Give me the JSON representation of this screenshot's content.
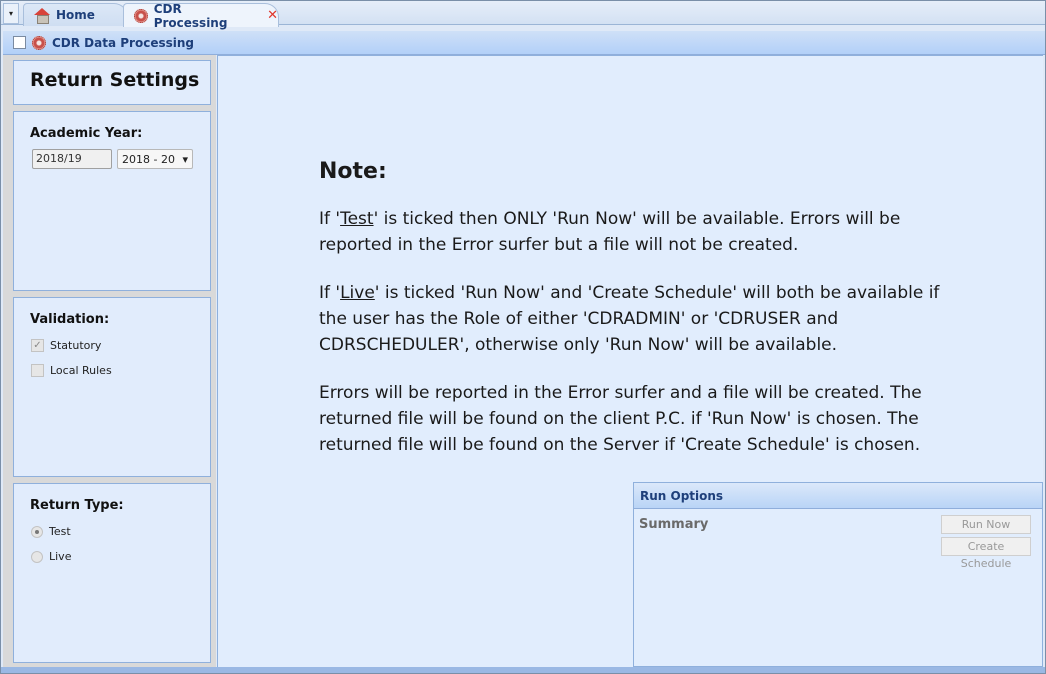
{
  "tabs": [
    {
      "label": "Home",
      "icon": "home-icon",
      "active": false
    },
    {
      "label": "CDR Processing",
      "icon": "gear-icon",
      "active": true,
      "close": "✕"
    }
  ],
  "tab_menu_glyph": "▾",
  "subheader": {
    "title": "CDR Data Processing",
    "checked": false
  },
  "left": {
    "title": "Return Settings",
    "academic_year": {
      "label": "Academic Year:",
      "field_value": "2018/19",
      "select_value": "2018 - 20",
      "select_arrow": "▾"
    },
    "validation": {
      "label": "Validation:",
      "options": [
        {
          "label": "Statutory",
          "checked": true,
          "mark": "✓"
        },
        {
          "label": "Local Rules",
          "checked": false,
          "mark": ""
        }
      ]
    },
    "return_type": {
      "label": "Return Type:",
      "options": [
        {
          "label": "Test",
          "selected": true
        },
        {
          "label": "Live",
          "selected": false
        }
      ]
    }
  },
  "note": {
    "heading": "Note:",
    "p1_prefix": "If '",
    "p1_link": "Test",
    "p1_suffix": "' is ticked then ONLY 'Run Now' will be available. Errors will be reported in the Error surfer but a file will not be created.",
    "p2_prefix": "If '",
    "p2_link": "Live",
    "p2_suffix": "' is ticked 'Run Now' and 'Create Schedule' will both be available if the user has the Role of either 'CDRADMIN' or 'CDRUSER and CDRSCHEDULER', otherwise only 'Run Now' will be available.",
    "p3": "Errors will be reported in the Error surfer and a file will be created. The returned file will be found on the client P.C. if 'Run Now' is chosen. The returned file will be found on the Server if 'Create Schedule' is chosen."
  },
  "run_options": {
    "title": "Run Options",
    "summary_label": "Summary",
    "run_now_label": "Run Now",
    "create_schedule_label": "Create Schedule"
  }
}
